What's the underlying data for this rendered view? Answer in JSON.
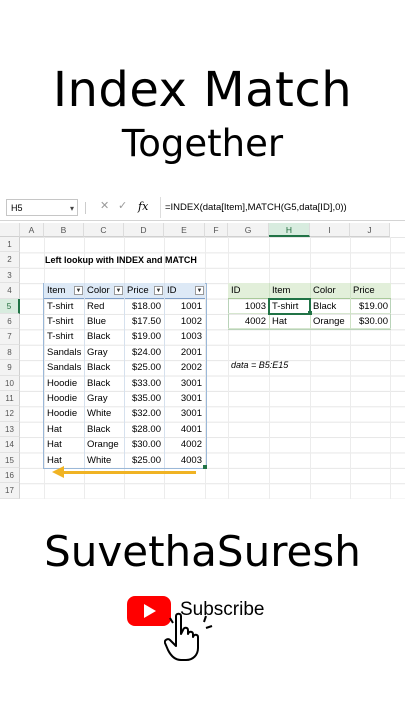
{
  "title_line1": "Index Match",
  "title_line2": "Together",
  "channel": "SuvethaSuresh",
  "subscribe": "Subscribe",
  "excel": {
    "name_box": "H5",
    "cancel_icon": "✕",
    "enter_icon": "✓",
    "fx": "fx",
    "formula": "=INDEX(data[Item],MATCH(G5,data[ID],0))",
    "columns": [
      "A",
      "B",
      "C",
      "D",
      "E",
      "F",
      "G",
      "H",
      "I",
      "J"
    ],
    "rows": [
      "1",
      "2",
      "3",
      "4",
      "5",
      "6",
      "7",
      "8",
      "9",
      "10",
      "11",
      "12",
      "13",
      "14",
      "15",
      "16",
      "17"
    ],
    "heading": "Left lookup with INDEX and MATCH",
    "table_headers": [
      "Item",
      "Color",
      "Price",
      "ID"
    ],
    "table_rows": [
      [
        "T-shirt",
        "Red",
        "$18.00",
        "1001"
      ],
      [
        "T-shirt",
        "Blue",
        "$17.50",
        "1002"
      ],
      [
        "T-shirt",
        "Black",
        "$19.00",
        "1003"
      ],
      [
        "Sandals",
        "Gray",
        "$24.00",
        "2001"
      ],
      [
        "Sandals",
        "Black",
        "$25.00",
        "2002"
      ],
      [
        "Hoodie",
        "Black",
        "$33.00",
        "3001"
      ],
      [
        "Hoodie",
        "Gray",
        "$35.00",
        "3001"
      ],
      [
        "Hoodie",
        "White",
        "$32.00",
        "3001"
      ],
      [
        "Hat",
        "Black",
        "$28.00",
        "4001"
      ],
      [
        "Hat",
        "Orange",
        "$30.00",
        "4002"
      ],
      [
        "Hat",
        "White",
        "$25.00",
        "4003"
      ]
    ],
    "lookup_headers": [
      "ID",
      "Item",
      "Color",
      "Price"
    ],
    "lookup_rows": [
      [
        "1003",
        "T-shirt",
        "Black",
        "$19.00"
      ],
      [
        "4002",
        "Hat",
        "Orange",
        "$30.00"
      ]
    ],
    "note": "data = B5:E15",
    "accent": "#217346",
    "arrow_color": "#f0b323"
  }
}
